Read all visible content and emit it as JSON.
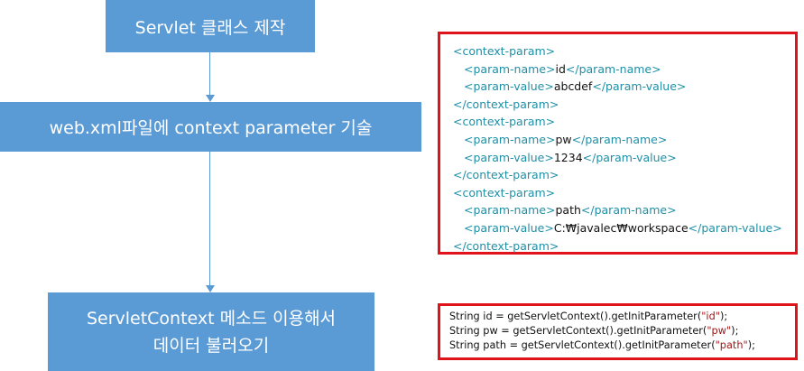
{
  "steps": [
    {
      "lines": [
        "Servlet 클래스 제작"
      ]
    },
    {
      "lines": [
        "web.xml파일에 context parameter 기술"
      ]
    },
    {
      "lines": [
        "ServletContext 메소드 이용해서",
        "데이터 불러오기"
      ]
    }
  ],
  "xml": {
    "params": [
      {
        "name": "id",
        "value": "abcdef"
      },
      {
        "name": "pw",
        "value": "1234"
      },
      {
        "name": "path",
        "value": "C:₩javalec₩workspace"
      }
    ],
    "tags": {
      "context_open": "<context-param>",
      "context_close": "</context-param>",
      "name_open": "<param-name>",
      "name_close": "</param-name>",
      "value_open": "<param-value>",
      "value_close": "</param-value>"
    }
  },
  "code": {
    "lines": [
      {
        "prefix": "String id = getServletContext().getInitParameter(",
        "arg": "\"id\"",
        "suffix": ");"
      },
      {
        "prefix": "String pw = getServletContext().getInitParameter(",
        "arg": "\"pw\"",
        "suffix": ");"
      },
      {
        "prefix": "String path = getServletContext().getInitParameter(",
        "arg": "\"path\"",
        "suffix": ");"
      }
    ]
  },
  "colors": {
    "box_fill": "#5b9bd5",
    "highlight_border": "#e0121a",
    "xml_tag": "#1f8fa6",
    "string_literal": "#a31515"
  }
}
